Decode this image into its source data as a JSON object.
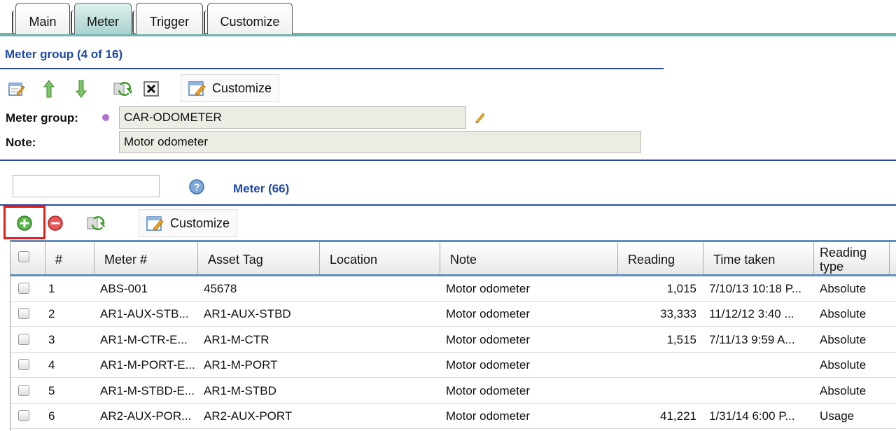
{
  "tabs": [
    {
      "label": "Main",
      "active": false
    },
    {
      "label": "Meter",
      "active": true
    },
    {
      "label": "Trigger",
      "active": false
    },
    {
      "label": "Customize",
      "active": false
    }
  ],
  "meter_group_section": {
    "title": "Meter group (4 of 16)",
    "customize_label": "Customize",
    "meter_group_label": "Meter group:",
    "meter_group_value": "CAR-ODOMETER",
    "note_label": "Note:",
    "note_value": "Motor odometer"
  },
  "meter_section": {
    "search_value": "",
    "title": "Meter (66)",
    "customize_label": "Customize"
  },
  "table": {
    "columns": [
      "#",
      "Meter #",
      "Asset Tag",
      "Location",
      "Note",
      "Reading",
      "Time taken",
      "Reading type"
    ],
    "rows": [
      {
        "num": "1",
        "meter": "ABS-001",
        "asset_tag": "45678",
        "location": "",
        "note": "Motor odometer",
        "reading": "1,015",
        "time_taken": "7/10/13 10:18 P...",
        "reading_type": "Absolute"
      },
      {
        "num": "2",
        "meter": "AR1-AUX-STB...",
        "asset_tag": "AR1-AUX-STBD",
        "location": "",
        "note": "Motor odometer",
        "reading": "33,333",
        "time_taken": "11/12/12 3:40 ...",
        "reading_type": "Absolute"
      },
      {
        "num": "3",
        "meter": "AR1-M-CTR-E...",
        "asset_tag": "AR1-M-CTR",
        "location": "",
        "note": "Motor odometer",
        "reading": "1,515",
        "time_taken": "7/11/13 9:59 A...",
        "reading_type": "Absolute"
      },
      {
        "num": "4",
        "meter": "AR1-M-PORT-E...",
        "asset_tag": "AR1-M-PORT",
        "location": "",
        "note": "Motor odometer",
        "reading": "",
        "time_taken": "",
        "reading_type": "Absolute"
      },
      {
        "num": "5",
        "meter": "AR1-M-STBD-E...",
        "asset_tag": "AR1-M-STBD",
        "location": "",
        "note": "Motor odometer",
        "reading": "",
        "time_taken": "",
        "reading_type": "Absolute"
      },
      {
        "num": "6",
        "meter": "AR2-AUX-POR...",
        "asset_tag": "AR2-AUX-PORT",
        "location": "",
        "note": "Motor odometer",
        "reading": "41,221",
        "time_taken": "1/31/14 6:00 P...",
        "reading_type": "Usage"
      }
    ]
  },
  "colors": {
    "accent_blue": "#1e49a8",
    "tab_teal": "#6fb3ad",
    "highlight_red": "#e0201c"
  }
}
